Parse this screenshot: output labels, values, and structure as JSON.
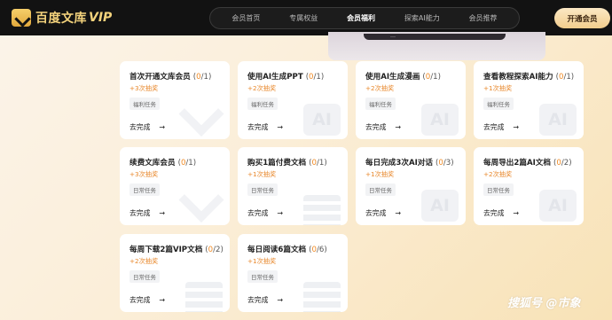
{
  "brand": {
    "name": "百度文库",
    "vip": "VIP"
  },
  "nav": [
    {
      "label": "会员首页",
      "active": false
    },
    {
      "label": "专属权益",
      "active": false
    },
    {
      "label": "会员福利",
      "active": true
    },
    {
      "label": "探索AI能力",
      "active": false
    },
    {
      "label": "会员推荐",
      "active": false
    }
  ],
  "open_button": "开通会员",
  "banner_text": "…",
  "cards": [
    {
      "title": "首次开通文库会员",
      "prog_open": "(",
      "current": "0",
      "total": "/1)",
      "reward": "+3次抽奖",
      "tag": "福利任务",
      "action": "去完成",
      "arrow": "→",
      "deco": "v"
    },
    {
      "title": "使用AI生成PPT",
      "prog_open": "(",
      "current": "0",
      "total": "/1)",
      "reward": "+2次抽奖",
      "tag": "福利任务",
      "action": "去完成",
      "arrow": "→",
      "deco": "ai"
    },
    {
      "title": "使用AI生成漫画",
      "prog_open": "(",
      "current": "0",
      "total": "/1)",
      "reward": "+2次抽奖",
      "tag": "福利任务",
      "action": "去完成",
      "arrow": "→",
      "deco": "ai"
    },
    {
      "title": "查看教程探索AI能力",
      "prog_open": "(",
      "current": "0",
      "total": "/1)",
      "reward": "+1次抽奖",
      "tag": "福利任务",
      "action": "去完成",
      "arrow": "→",
      "deco": "ai"
    },
    {
      "title": "续费文库会员",
      "prog_open": "(",
      "current": "0",
      "total": "/1)",
      "reward": "+3次抽奖",
      "tag": "日常任务",
      "action": "去完成",
      "arrow": "→",
      "deco": "v"
    },
    {
      "title": "购买1篇付费文档",
      "prog_open": "(",
      "current": "0",
      "total": "/1)",
      "reward": "+1次抽奖",
      "tag": "日常任务",
      "action": "去完成",
      "arrow": "→",
      "deco": "doc"
    },
    {
      "title": "每日完成3次AI对话",
      "prog_open": "(",
      "current": "0",
      "total": "/3)",
      "reward": "+1次抽奖",
      "tag": "日常任务",
      "action": "去完成",
      "arrow": "→",
      "deco": "ai"
    },
    {
      "title": "每周导出2篇AI文档",
      "prog_open": "(",
      "current": "0",
      "total": "/2)",
      "reward": "+2次抽奖",
      "tag": "日常任务",
      "action": "去完成",
      "arrow": "→",
      "deco": "ai"
    },
    {
      "title": "每周下载2篇VIP文档",
      "prog_open": "(",
      "current": "0",
      "total": "/2)",
      "reward": "+2次抽奖",
      "tag": "日常任务",
      "action": "去完成",
      "arrow": "→",
      "deco": "doc"
    },
    {
      "title": "每日阅读6篇文档",
      "prog_open": "(",
      "current": "0",
      "total": "/6)",
      "reward": "+1次抽奖",
      "tag": "日常任务",
      "action": "去完成",
      "arrow": "→",
      "deco": "doc"
    }
  ],
  "watermark": "搜狐号 @市象"
}
